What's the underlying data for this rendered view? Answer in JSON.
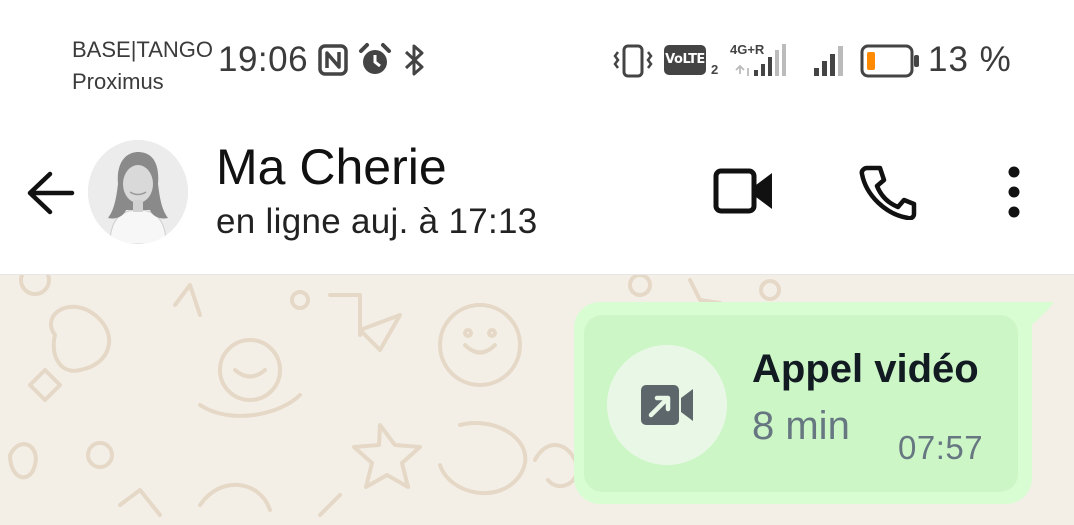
{
  "status_bar": {
    "carrier_line1": "BASE|TANGO",
    "carrier_line2": "Proximus",
    "time": "19:06",
    "volte_label": "VoLTE",
    "volte_sim": "2",
    "network_label": "4G+R",
    "battery_percent": "13 %",
    "battery_level": 0.13,
    "icons": [
      "nfc-icon",
      "alarm-icon",
      "bluetooth-icon",
      "vibrate-icon",
      "volte-icon",
      "signal-sim2-icon",
      "signal-sim1-icon",
      "battery-icon"
    ]
  },
  "header": {
    "contact_name": "Ma Cherie",
    "last_seen": "en ligne auj. à 17:13",
    "icons": [
      "back-arrow-icon",
      "video-call-icon",
      "phone-call-icon",
      "more-options-icon"
    ]
  },
  "messages": [
    {
      "type": "call",
      "direction": "outgoing",
      "title": "Appel vidéo",
      "duration": "8 min",
      "time": "07:57",
      "icon": "outgoing-video-call-icon"
    }
  ],
  "colors": {
    "chat_background": "#f3efe7",
    "bubble_outgoing": "#d8fdd2",
    "bubble_inner": "#cdf6c6",
    "battery_low": "#ff8a00"
  }
}
